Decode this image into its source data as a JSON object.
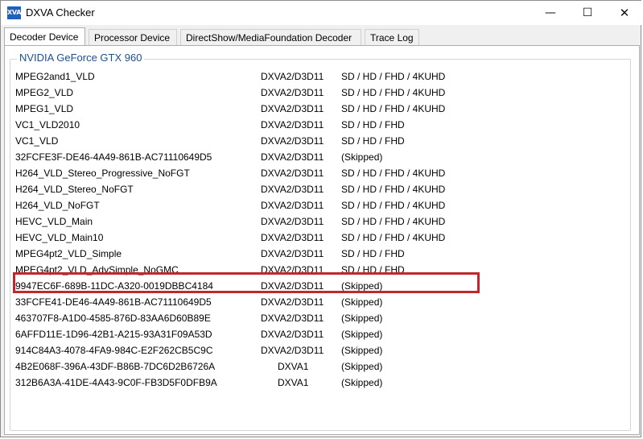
{
  "window": {
    "app_icon_text": "XVA",
    "title": "DXVA Checker",
    "controls": {
      "minimize": "—",
      "maximize": "☐",
      "close": "✕"
    }
  },
  "tabs": [
    {
      "label": "Decoder Device",
      "active": true
    },
    {
      "label": "Processor Device",
      "active": false
    },
    {
      "label": "DirectShow/MediaFoundation Decoder",
      "active": false
    },
    {
      "label": "Trace Log",
      "active": false
    }
  ],
  "group": {
    "label": "NVIDIA GeForce GTX 960"
  },
  "decoders": [
    {
      "name": "MPEG2and1_VLD",
      "api": "DXVA2/D3D11",
      "resolutions": "SD / HD / FHD / 4KUHD"
    },
    {
      "name": "MPEG2_VLD",
      "api": "DXVA2/D3D11",
      "resolutions": "SD / HD / FHD / 4KUHD"
    },
    {
      "name": "MPEG1_VLD",
      "api": "DXVA2/D3D11",
      "resolutions": "SD / HD / FHD / 4KUHD"
    },
    {
      "name": "VC1_VLD2010",
      "api": "DXVA2/D3D11",
      "resolutions": "SD / HD / FHD"
    },
    {
      "name": "VC1_VLD",
      "api": "DXVA2/D3D11",
      "resolutions": "SD / HD / FHD"
    },
    {
      "name": "32FCFE3F-DE46-4A49-861B-AC71110649D5",
      "api": "DXVA2/D3D11",
      "resolutions": "(Skipped)"
    },
    {
      "name": "H264_VLD_Stereo_Progressive_NoFGT",
      "api": "DXVA2/D3D11",
      "resolutions": "SD / HD / FHD / 4KUHD"
    },
    {
      "name": "H264_VLD_Stereo_NoFGT",
      "api": "DXVA2/D3D11",
      "resolutions": "SD / HD / FHD / 4KUHD"
    },
    {
      "name": "H264_VLD_NoFGT",
      "api": "DXVA2/D3D11",
      "resolutions": "SD / HD / FHD / 4KUHD"
    },
    {
      "name": "HEVC_VLD_Main",
      "api": "DXVA2/D3D11",
      "resolutions": "SD / HD / FHD / 4KUHD"
    },
    {
      "name": "HEVC_VLD_Main10",
      "api": "DXVA2/D3D11",
      "resolutions": "SD / HD / FHD / 4KUHD",
      "highlighted": true
    },
    {
      "name": "MPEG4pt2_VLD_Simple",
      "api": "DXVA2/D3D11",
      "resolutions": "SD / HD / FHD"
    },
    {
      "name": "MPEG4pt2_VLD_AdvSimple_NoGMC",
      "api": "DXVA2/D3D11",
      "resolutions": "SD / HD / FHD"
    },
    {
      "name": "9947EC6F-689B-11DC-A320-0019DBBC4184",
      "api": "DXVA2/D3D11",
      "resolutions": "(Skipped)"
    },
    {
      "name": "33FCFE41-DE46-4A49-861B-AC71110649D5",
      "api": "DXVA2/D3D11",
      "resolutions": "(Skipped)"
    },
    {
      "name": "463707F8-A1D0-4585-876D-83AA6D60B89E",
      "api": "DXVA2/D3D11",
      "resolutions": "(Skipped)"
    },
    {
      "name": "6AFFD11E-1D96-42B1-A215-93A31F09A53D",
      "api": "DXVA2/D3D11",
      "resolutions": "(Skipped)"
    },
    {
      "name": "914C84A3-4078-4FA9-984C-E2F262CB5C9C",
      "api": "DXVA2/D3D11",
      "resolutions": "(Skipped)"
    },
    {
      "name": "4B2E068F-396A-43DF-B86B-7DC6D2B6726A",
      "api": "DXVA1",
      "resolutions": "(Skipped)"
    },
    {
      "name": "312B6A3A-41DE-4A43-9C0F-FB3D5F0DFB9A",
      "api": "DXVA1",
      "resolutions": "(Skipped)"
    }
  ],
  "colors": {
    "highlight_border": "#c1272d",
    "group_label": "#1e4e90",
    "app_icon_bg": "#1f5fbf"
  }
}
